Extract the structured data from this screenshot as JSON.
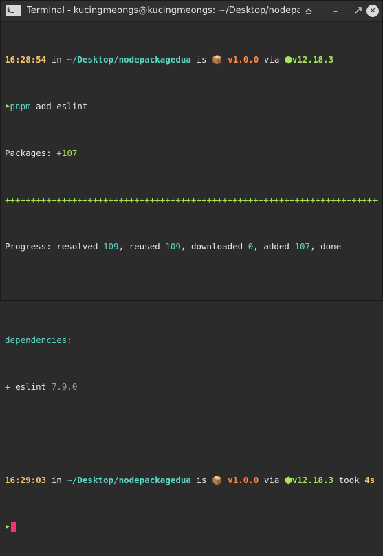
{
  "window": {
    "app_icon_text": "$_",
    "title": "Terminal - kucingmeongs@kucingmeongs: ~/Desktop/nodepackag",
    "minimize_glyph": "–",
    "close_glyph": "✕"
  },
  "terminal": {
    "prompt1": {
      "time": "16:28:54",
      "in": " in ",
      "path": "~/Desktop/nodepackagedua",
      "is": " is ",
      "pkg_icon": "📦",
      "pkg_version": " v1.0.0",
      "via": " via ",
      "node_icon": "⬢",
      "node_version": "v12.18.3"
    },
    "command_line": {
      "arrow": "➤",
      "cmd": "pnpm",
      "args": " add eslint"
    },
    "packages_line": {
      "label": "Packages: ",
      "value": "+107"
    },
    "progress_bar": "++++++++++++++++++++++++++++++++++++++++++++++++++++++++++++++++++++++++++++++++",
    "progress_line": {
      "prefix": "Progress: resolved ",
      "resolved": "109",
      "reused_label": ", reused ",
      "reused": "109",
      "downloaded_label": ", downloaded ",
      "downloaded": "0",
      "added_label": ", added ",
      "added": "107",
      "done": ", done"
    },
    "dependencies_header": "dependencies:",
    "dependency": {
      "plus": "+ ",
      "name": "eslint",
      "version": " 7.9.0"
    },
    "prompt2": {
      "time": "16:29:03",
      "in": " in ",
      "path": "~/Desktop/nodepackagedua",
      "is": " is ",
      "pkg_icon": "📦",
      "pkg_version": " v1.0.0",
      "via": " via ",
      "node_icon": "⬢",
      "node_version": "v12.18.3",
      "took": " took ",
      "duration": "4s"
    },
    "prompt_arrow": "➤"
  },
  "colors": {
    "background": "#2b2b2b",
    "time": "#f5c56b",
    "path": "#5ed6c8",
    "package": "#ff8a3d",
    "node": "#a6e75a",
    "cursor": "#f0356f"
  }
}
